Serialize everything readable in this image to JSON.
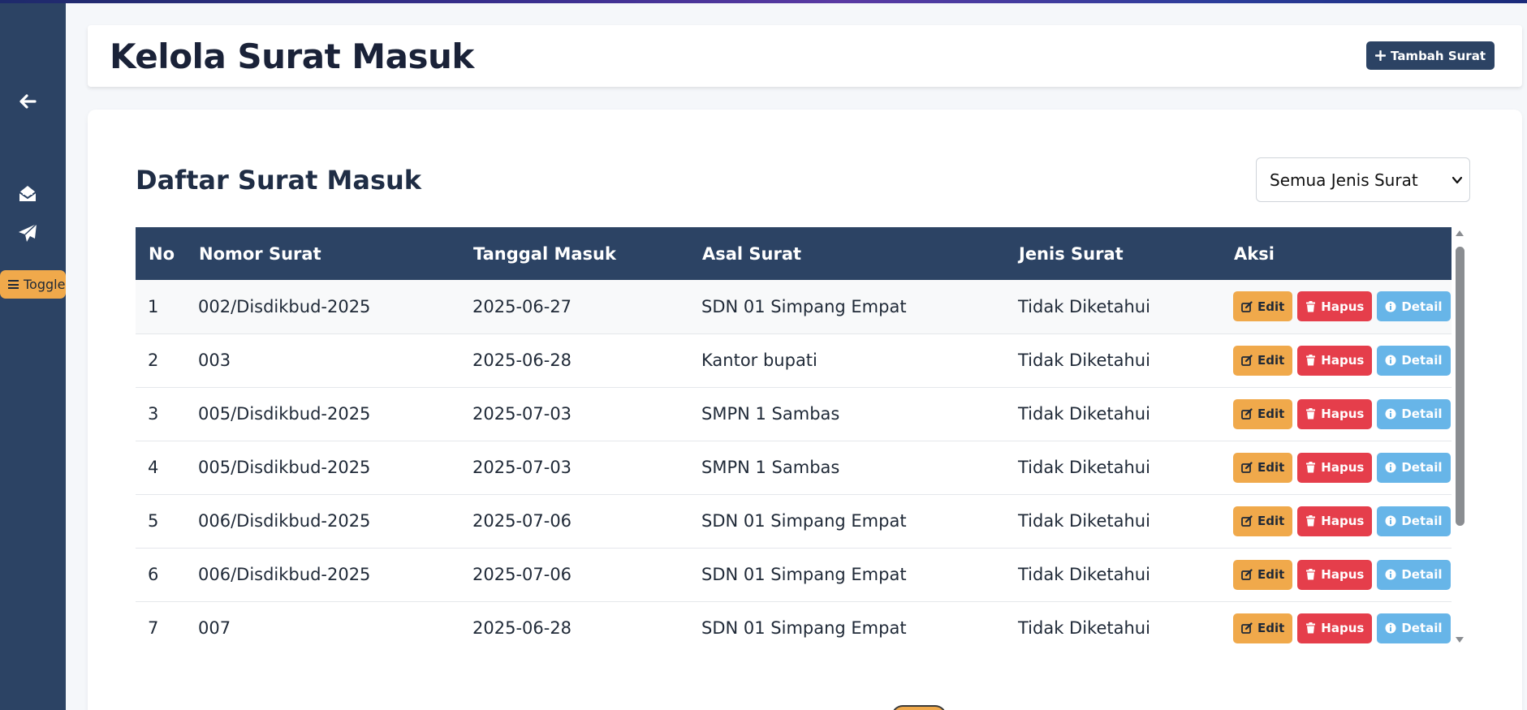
{
  "sidebar": {
    "toggle_label": "Toggle",
    "icons": [
      "arrow-left-icon",
      "envelope-open-icon",
      "paper-plane-icon",
      "bars-icon"
    ]
  },
  "header": {
    "title": "Kelola Surat Masuk",
    "add_button_label": "Tambah Surat"
  },
  "list": {
    "title": "Daftar Surat Masuk",
    "filter": {
      "selected": "Semua Jenis Surat"
    },
    "columns": [
      "No",
      "Nomor Surat",
      "Tanggal Masuk",
      "Asal Surat",
      "Jenis Surat",
      "Aksi"
    ],
    "rows": [
      {
        "no": "1",
        "nomor": "002/Disdikbud-2025",
        "tanggal": "2025-06-27",
        "asal": "SDN 01 Simpang Empat",
        "jenis": "Tidak Diketahui"
      },
      {
        "no": "2",
        "nomor": "003",
        "tanggal": "2025-06-28",
        "asal": "Kantor bupati",
        "jenis": "Tidak Diketahui"
      },
      {
        "no": "3",
        "nomor": "005/Disdikbud-2025",
        "tanggal": "2025-07-03",
        "asal": "SMPN 1 Sambas",
        "jenis": "Tidak Diketahui"
      },
      {
        "no": "4",
        "nomor": "005/Disdikbud-2025",
        "tanggal": "2025-07-03",
        "asal": "SMPN 1 Sambas",
        "jenis": "Tidak Diketahui"
      },
      {
        "no": "5",
        "nomor": "006/Disdikbud-2025",
        "tanggal": "2025-07-06",
        "asal": "SDN 01 Simpang Empat",
        "jenis": "Tidak Diketahui"
      },
      {
        "no": "6",
        "nomor": "006/Disdikbud-2025",
        "tanggal": "2025-07-06",
        "asal": "SDN 01 Simpang Empat",
        "jenis": "Tidak Diketahui"
      },
      {
        "no": "7",
        "nomor": "007",
        "tanggal": "2025-06-28",
        "asal": "SDN 01 Simpang Empat",
        "jenis": "Tidak Diketahui"
      }
    ],
    "actions": {
      "edit": "Edit",
      "hapus": "Hapus",
      "detail": "Detail"
    }
  },
  "colors": {
    "sidebar": "#2c4364",
    "accent_orange": "#f0a94b",
    "danger": "#e53e4b",
    "info": "#67b5e8"
  }
}
